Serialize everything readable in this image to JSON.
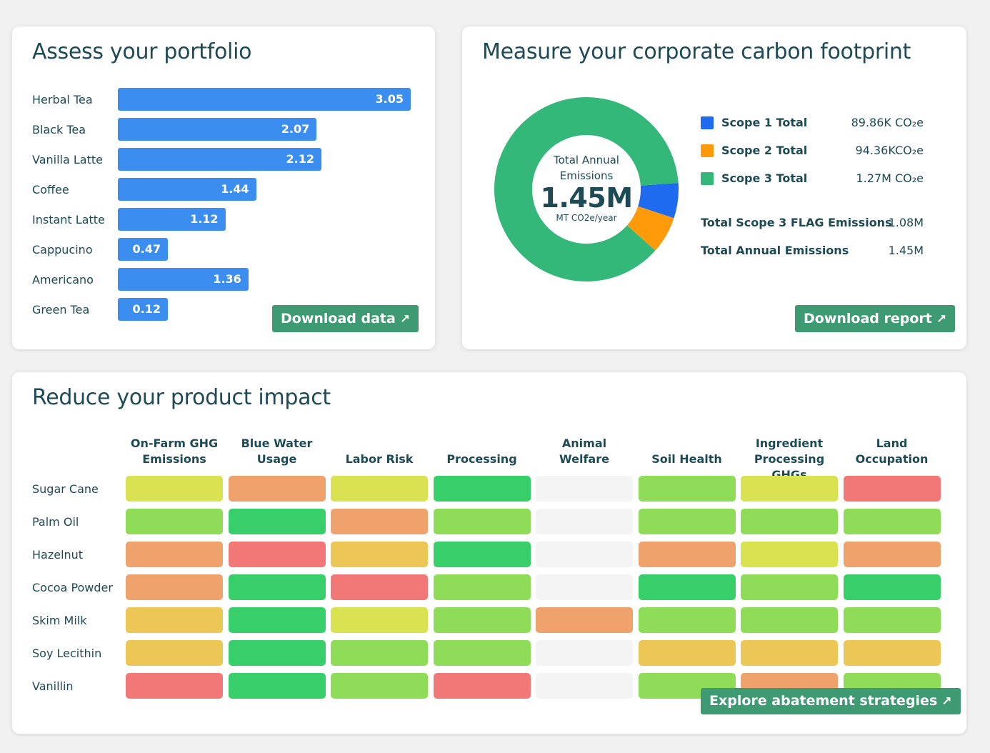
{
  "colors": {
    "accent_button": "#3e9a72",
    "bar": "#3b8ef0",
    "scope1": "#1f6bf0",
    "scope2": "#ff9b0a",
    "scope3": "#34b87a",
    "heat": {
      "dark_green": "#38cf6a",
      "green": "#8edc58",
      "yellow_green": "#d9e251",
      "yellow": "#ecc756",
      "orange": "#f0a26c",
      "red": "#f27878",
      "gray": "#f4f4f4"
    }
  },
  "portfolio": {
    "title": "Assess your portfolio",
    "download_label": "Download data",
    "chart_data": {
      "type": "bar",
      "categories": [
        "Herbal Tea",
        "Black Tea",
        "Vanilla Latte",
        "Coffee",
        "Instant Latte",
        "Cappucino",
        "Americano",
        "Green Tea"
      ],
      "values": [
        3.05,
        2.07,
        2.12,
        1.44,
        1.12,
        0.47,
        1.36,
        0.12
      ],
      "value_labels": [
        "3.05",
        "2.07",
        "2.12",
        "1.44",
        "1.12",
        "0.47",
        "1.36",
        "0.12"
      ]
    }
  },
  "carbon": {
    "title": "Measure your corporate carbon footprint",
    "center": {
      "line1": "Total Annual",
      "line2": "Emissions",
      "value": "1.45M",
      "unit": "MT CO2e/year"
    },
    "legend": [
      {
        "label": "Scope 1 Total",
        "value": "89.86K CO₂e",
        "color": "#1f6bf0"
      },
      {
        "label": "Scope 2 Total",
        "value": "94.36KCO₂e",
        "color": "#ff9b0a"
      },
      {
        "label": "Scope 3 Total",
        "value": "1.27M CO₂e",
        "color": "#34b87a"
      }
    ],
    "totals": [
      {
        "label": "Total Scope 3 FLAG Emissions",
        "value": "1.08M"
      },
      {
        "label": "Total Annual Emissions",
        "value": "1.45M"
      }
    ],
    "download_label": "Download report",
    "chart_data": {
      "type": "pie",
      "donut": true,
      "labels": [
        "Scope 1 Total",
        "Scope 2 Total",
        "Scope 3 Total"
      ],
      "values": [
        89.86,
        94.36,
        1270
      ],
      "units": "K CO2e"
    }
  },
  "impact": {
    "title": "Reduce your product impact",
    "columns": [
      [
        "On-Farm GHG",
        "Emissions"
      ],
      [
        "Blue Water",
        "Usage"
      ],
      [
        "",
        "Labor Risk"
      ],
      [
        "",
        "Processing"
      ],
      [
        "Animal",
        "Welfare"
      ],
      [
        "",
        "Soil Health"
      ],
      [
        "Ingredient",
        "Processing GHGs"
      ],
      [
        "Land",
        "Occupation"
      ]
    ],
    "rows": [
      {
        "label": "Sugar Cane",
        "cells": [
          "yellow_green",
          "orange",
          "yellow_green",
          "dark_green",
          "gray",
          "green",
          "yellow_green",
          "red"
        ]
      },
      {
        "label": "Palm Oil",
        "cells": [
          "green",
          "dark_green",
          "orange",
          "green",
          "gray",
          "green",
          "green",
          "green"
        ]
      },
      {
        "label": "Hazelnut",
        "cells": [
          "orange",
          "red",
          "yellow",
          "dark_green",
          "gray",
          "orange",
          "yellow_green",
          "orange"
        ]
      },
      {
        "label": "Cocoa Powder",
        "cells": [
          "orange",
          "dark_green",
          "red",
          "green",
          "gray",
          "dark_green",
          "green",
          "dark_green"
        ]
      },
      {
        "label": "Skim Milk",
        "cells": [
          "yellow",
          "dark_green",
          "yellow_green",
          "green",
          "orange",
          "green",
          "green",
          "green"
        ]
      },
      {
        "label": "Soy Lecithin",
        "cells": [
          "yellow",
          "dark_green",
          "green",
          "green",
          "gray",
          "yellow",
          "yellow",
          "yellow"
        ]
      },
      {
        "label": "Vanillin",
        "cells": [
          "red",
          "dark_green",
          "green",
          "red",
          "gray",
          "green",
          "orange",
          "green"
        ]
      }
    ],
    "explore_label": "Explore abatement strategies"
  }
}
